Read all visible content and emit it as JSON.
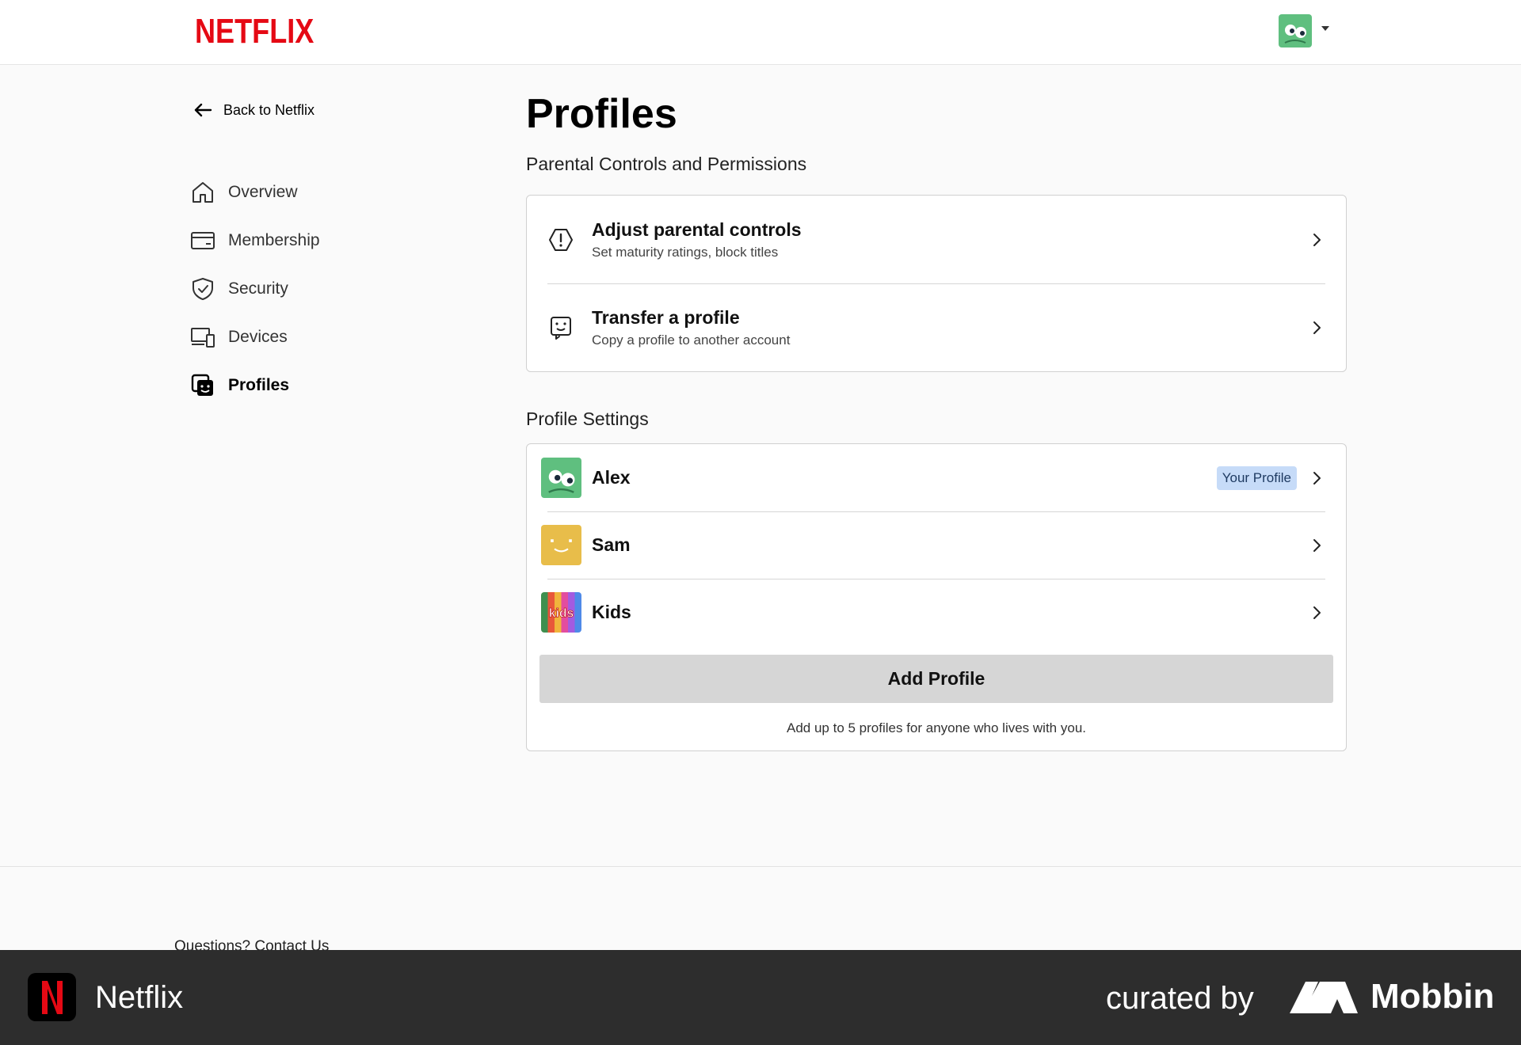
{
  "header": {
    "logo_text": "NETFLIX",
    "brand_color": "#e50914"
  },
  "sidebar": {
    "back_label": "Back to Netflix",
    "items": [
      {
        "label": "Overview",
        "icon": "home-icon"
      },
      {
        "label": "Membership",
        "icon": "card-icon"
      },
      {
        "label": "Security",
        "icon": "shield-icon"
      },
      {
        "label": "Devices",
        "icon": "devices-icon"
      },
      {
        "label": "Profiles",
        "icon": "profiles-icon",
        "active": true
      }
    ]
  },
  "main": {
    "title": "Profiles",
    "parental_section_title": "Parental Controls and Permissions",
    "parental_rows": [
      {
        "title": "Adjust parental controls",
        "subtitle": "Set maturity ratings, block titles",
        "icon": "warning-hexagon-icon"
      },
      {
        "title": "Transfer a profile",
        "subtitle": "Copy a profile to another account",
        "icon": "transfer-profile-icon"
      }
    ],
    "profile_section_title": "Profile Settings",
    "profiles": [
      {
        "name": "Alex",
        "badge": "Your Profile",
        "avatar_color": "#5fbf7f"
      },
      {
        "name": "Sam",
        "avatar_color": "#e8bd4a"
      },
      {
        "name": "Kids",
        "avatar_text": "kids"
      }
    ],
    "add_button_label": "Add Profile",
    "add_note": "Add up to 5 profiles for anyone who lives with you."
  },
  "footer": {
    "contact_label": "Questions? Contact Us"
  },
  "bar": {
    "app_name": "Netflix",
    "curated_label": "curated by",
    "mobbin_label": "Mobbin"
  }
}
